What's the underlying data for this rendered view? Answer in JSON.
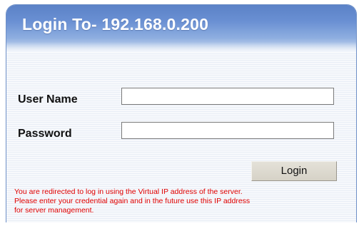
{
  "dialog": {
    "title": "Login To- 192.168.0.200"
  },
  "form": {
    "username_label": "User Name",
    "username_value": "",
    "password_label": "Password",
    "password_value": "",
    "login_button_label": "Login"
  },
  "message": {
    "lines": [
      "You are redirected to log in using the Virtual IP address of the server.",
      "Please enter your credential again and in the future use this IP address",
      "for server management."
    ]
  },
  "colors": {
    "title_bar": "#6a90d3",
    "title_text": "#ffffff",
    "message_text": "#e00000",
    "button_face": "#dcd8ce"
  }
}
